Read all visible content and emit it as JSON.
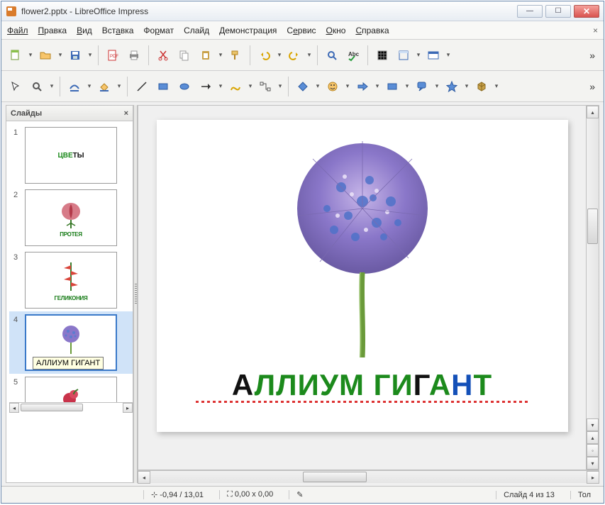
{
  "window": {
    "title": "flower2.pptx - LibreOffice Impress"
  },
  "menu": {
    "file": "Файл",
    "edit": "Правка",
    "view": "Вид",
    "insert": "Вставка",
    "format": "Формат",
    "slide": "Слайд",
    "demo": "Демонстрация",
    "service": "Сервис",
    "window": "Окно",
    "help": "Справка"
  },
  "panel": {
    "title": "Слайды",
    "close": "×"
  },
  "slides": [
    {
      "num": "1",
      "label": "ЦВЕТЫ"
    },
    {
      "num": "2",
      "label": "ПРОТЕЯ"
    },
    {
      "num": "3",
      "label": "ГЕЛИКОНИЯ"
    },
    {
      "num": "4",
      "label": "АЛЛИУМ ГИГАНТ"
    },
    {
      "num": "5",
      "label": ""
    }
  ],
  "tooltip": "АЛЛИУМ ГИГАНТ",
  "main_slide": {
    "letters": [
      {
        "t": "А",
        "c": "k"
      },
      {
        "t": "Л",
        "c": "g"
      },
      {
        "t": "Л",
        "c": "g"
      },
      {
        "t": "И",
        "c": "g"
      },
      {
        "t": "У",
        "c": "g"
      },
      {
        "t": "М",
        "c": "g"
      },
      {
        "t": " ",
        "c": "k"
      },
      {
        "t": "Г",
        "c": "g"
      },
      {
        "t": "И",
        "c": "g"
      },
      {
        "t": "Г",
        "c": "k"
      },
      {
        "t": "А",
        "c": "g"
      },
      {
        "t": "Н",
        "c": "b"
      },
      {
        "t": "Т",
        "c": "g"
      }
    ]
  },
  "status": {
    "coords": "-0,94 / 13,01",
    "size": "0,00 x 0,00",
    "slide_of": "Слайд 4 из 13",
    "right_trunc": "Тол"
  }
}
